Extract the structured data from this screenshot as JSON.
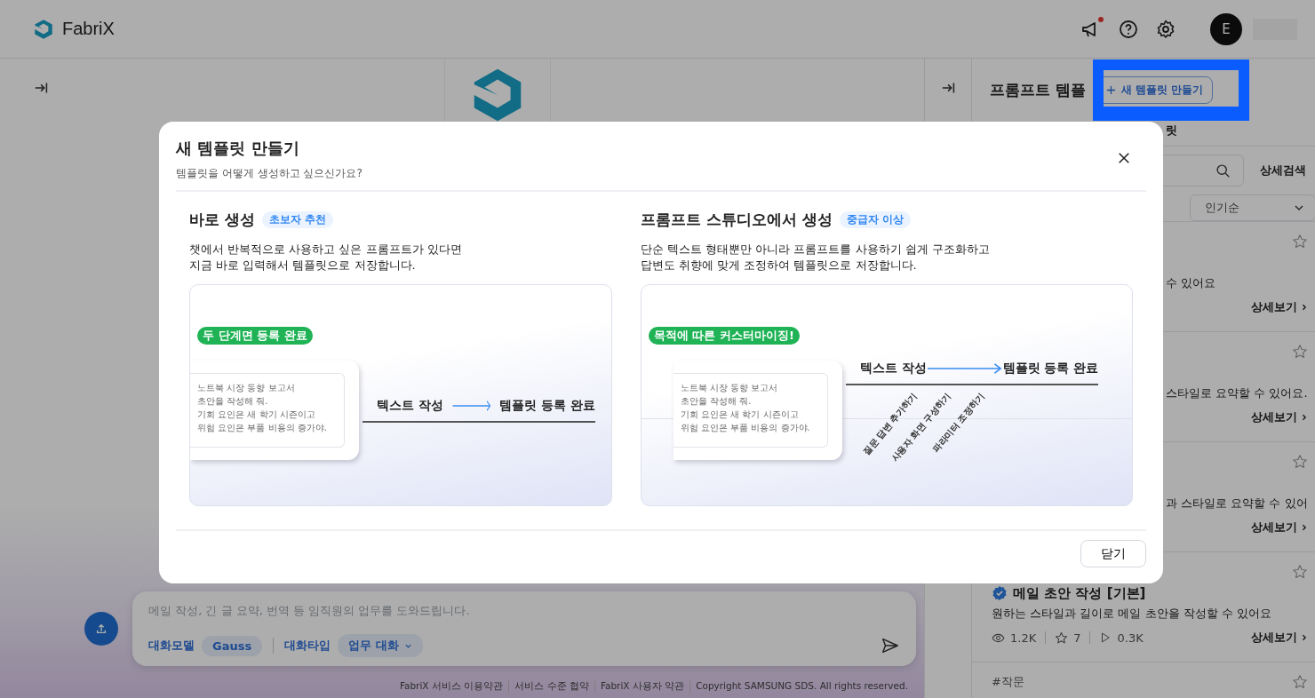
{
  "header": {
    "logo": "FabriX",
    "notification_dot": true,
    "avatar": "E"
  },
  "chat": {
    "placeholder": "메일 작성, 긴 글 요약, 번역 등 임직원의 업무를 도와드립니다.",
    "model_label": "대화모델",
    "model": "Gauss",
    "type_label": "대화타입",
    "type": "업무 대화"
  },
  "footer_links": [
    "FabriX 서비스 이용약관",
    "서비스 수준 협약",
    "FabriX 사용자 약관",
    "Copyright SAMSUNG SDS. All rights reserved."
  ],
  "template_panel": {
    "title": "프롬프트 템플",
    "new_button": "새 템플릿 만들기",
    "highlighted": true,
    "tab_fragment": "릿",
    "detail_search": "상세검색",
    "sort": "인기순",
    "cards": [
      {
        "description": "수 있어요",
        "detail": "상세보기",
        "favorite": false
      },
      {
        "description": "스타일로 요약할 수 있어요.",
        "detail": "상세보기",
        "favorite": false
      },
      {
        "description": "과 스타일로 요약할 수 있어",
        "detail": "상세보기",
        "favorite": false
      },
      {
        "title": "메일 초안 작성 [기본]",
        "verified": true,
        "description": "원하는 스타일과 길이로 메일 초안을 작성할 수 있어요",
        "views": "1.2K",
        "stars": "7",
        "runs": "0.3K",
        "detail": "상세보기",
        "favorite": false
      },
      {
        "tag": "#작문",
        "favorite": false
      }
    ]
  },
  "modal": {
    "title": "새 템플릿 만들기",
    "subtitle": "템플릿을 어떻게 생성하고 싶으신가요?",
    "close_button": "닫기",
    "options": [
      {
        "title": "바로 생성",
        "badge": "초보자 추천",
        "description": [
          "챗에서 반복적으로 사용하고 싶은 프롬프트가 있다면",
          "지금 바로 입력해서 템플릿으로 저장합니다."
        ],
        "highlight": "두 단계면 등록 완료",
        "note": [
          "노트북 시장 동향 보고서",
          "초안을 작성해 줘.",
          "기회 요인은 새 학기 시즌이고",
          "위험 요인은 부품 비용의 증가야."
        ],
        "step_from": "텍스트 작성",
        "step_to": "템플릿 등록 완료"
      },
      {
        "title": "프롬프트 스튜디오에서 생성",
        "badge": "중급자 이상",
        "description": [
          "단순 텍스트 형태뿐만 아니라 프롬프트를 사용하기 쉽게 구조화하고",
          "답변도 취향에 맞게 조정하여 템플릿으로 저장합니다."
        ],
        "highlight": "목적에 따른 커스터마이징!",
        "note": [
          "노트북 시장 동향 보고서",
          "초안을 작성해 줘.",
          "기회 요인은 새 학기 시즌이고",
          "위험 요인은 부품 비용의 증가야."
        ],
        "step_from": "텍스트 작성",
        "step_to": "템플릿 등록 완료",
        "sub_steps": [
          "질문 답변 추가하기",
          "사용자 화면 구성하기",
          "파라미터 조정하기"
        ]
      }
    ]
  }
}
